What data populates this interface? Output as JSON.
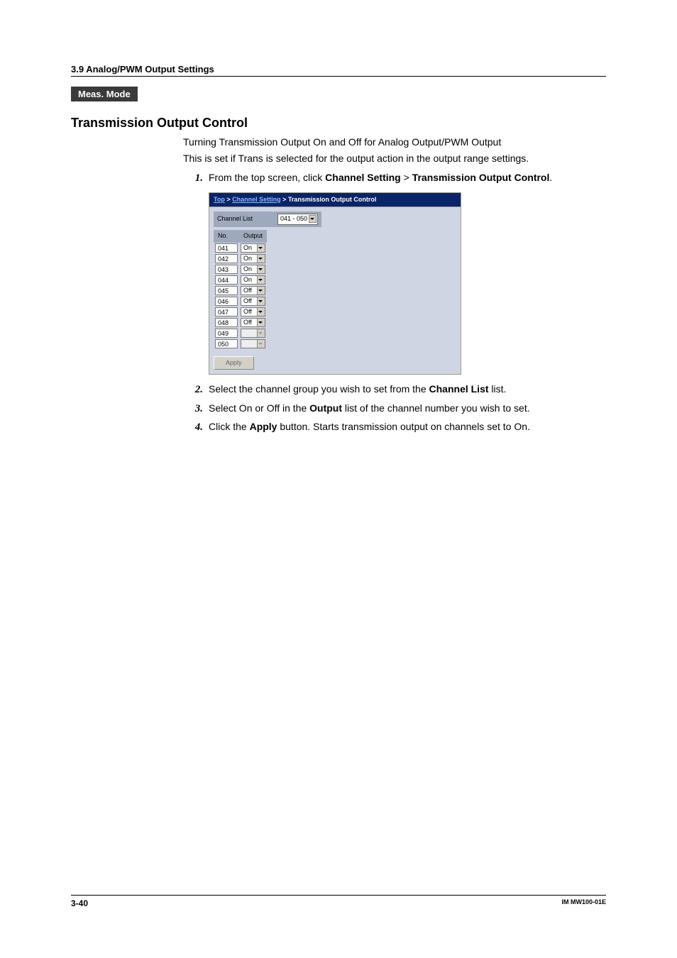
{
  "section_header": "3.9  Analog/PWM Output Settings",
  "mode_box": "Meas. Mode",
  "title": "Transmission Output Control",
  "intro1": "Turning Transmission Output On and Off for Analog Output/PWM Output",
  "intro2": "This is set if Trans is selected for the output action in the output range settings.",
  "steps": [
    {
      "num": "1.",
      "pre": "From the top screen, click ",
      "b1": "Channel Setting",
      "mid": " > ",
      "b2": "Transmission Output Control",
      "post": "."
    },
    {
      "num": "2.",
      "pre": "Select the channel group you wish to set from the ",
      "b1": "Channel List",
      "post": " list."
    },
    {
      "num": "3.",
      "pre": "Select On or Off in the ",
      "b1": "Output",
      "post": " list of the channel number you wish to set."
    },
    {
      "num": "4.",
      "pre": "Click the ",
      "b1": "Apply",
      "post": " button. Starts transmission output on channels set to On."
    }
  ],
  "shot": {
    "breadcrumb": {
      "top": "Top",
      "mid": "Channel Setting",
      "leaf": "Transmission Output Control"
    },
    "channel_list_label": "Channel List",
    "channel_list_value": "041 - 050",
    "col_no": "No.",
    "col_output": "Output",
    "rows": [
      {
        "no": "041",
        "out": "On",
        "disabled": false
      },
      {
        "no": "042",
        "out": "On",
        "disabled": false
      },
      {
        "no": "043",
        "out": "On",
        "disabled": false
      },
      {
        "no": "044",
        "out": "On",
        "disabled": false
      },
      {
        "no": "045",
        "out": "Off",
        "disabled": false
      },
      {
        "no": "046",
        "out": "Off",
        "disabled": false
      },
      {
        "no": "047",
        "out": "Off",
        "disabled": false
      },
      {
        "no": "048",
        "out": "Off",
        "disabled": false
      },
      {
        "no": "049",
        "out": "",
        "disabled": true
      },
      {
        "no": "050",
        "out": "",
        "disabled": true
      }
    ],
    "apply": "Apply"
  },
  "footer": {
    "page": "3-40",
    "doc": "IM MW100-01E"
  }
}
